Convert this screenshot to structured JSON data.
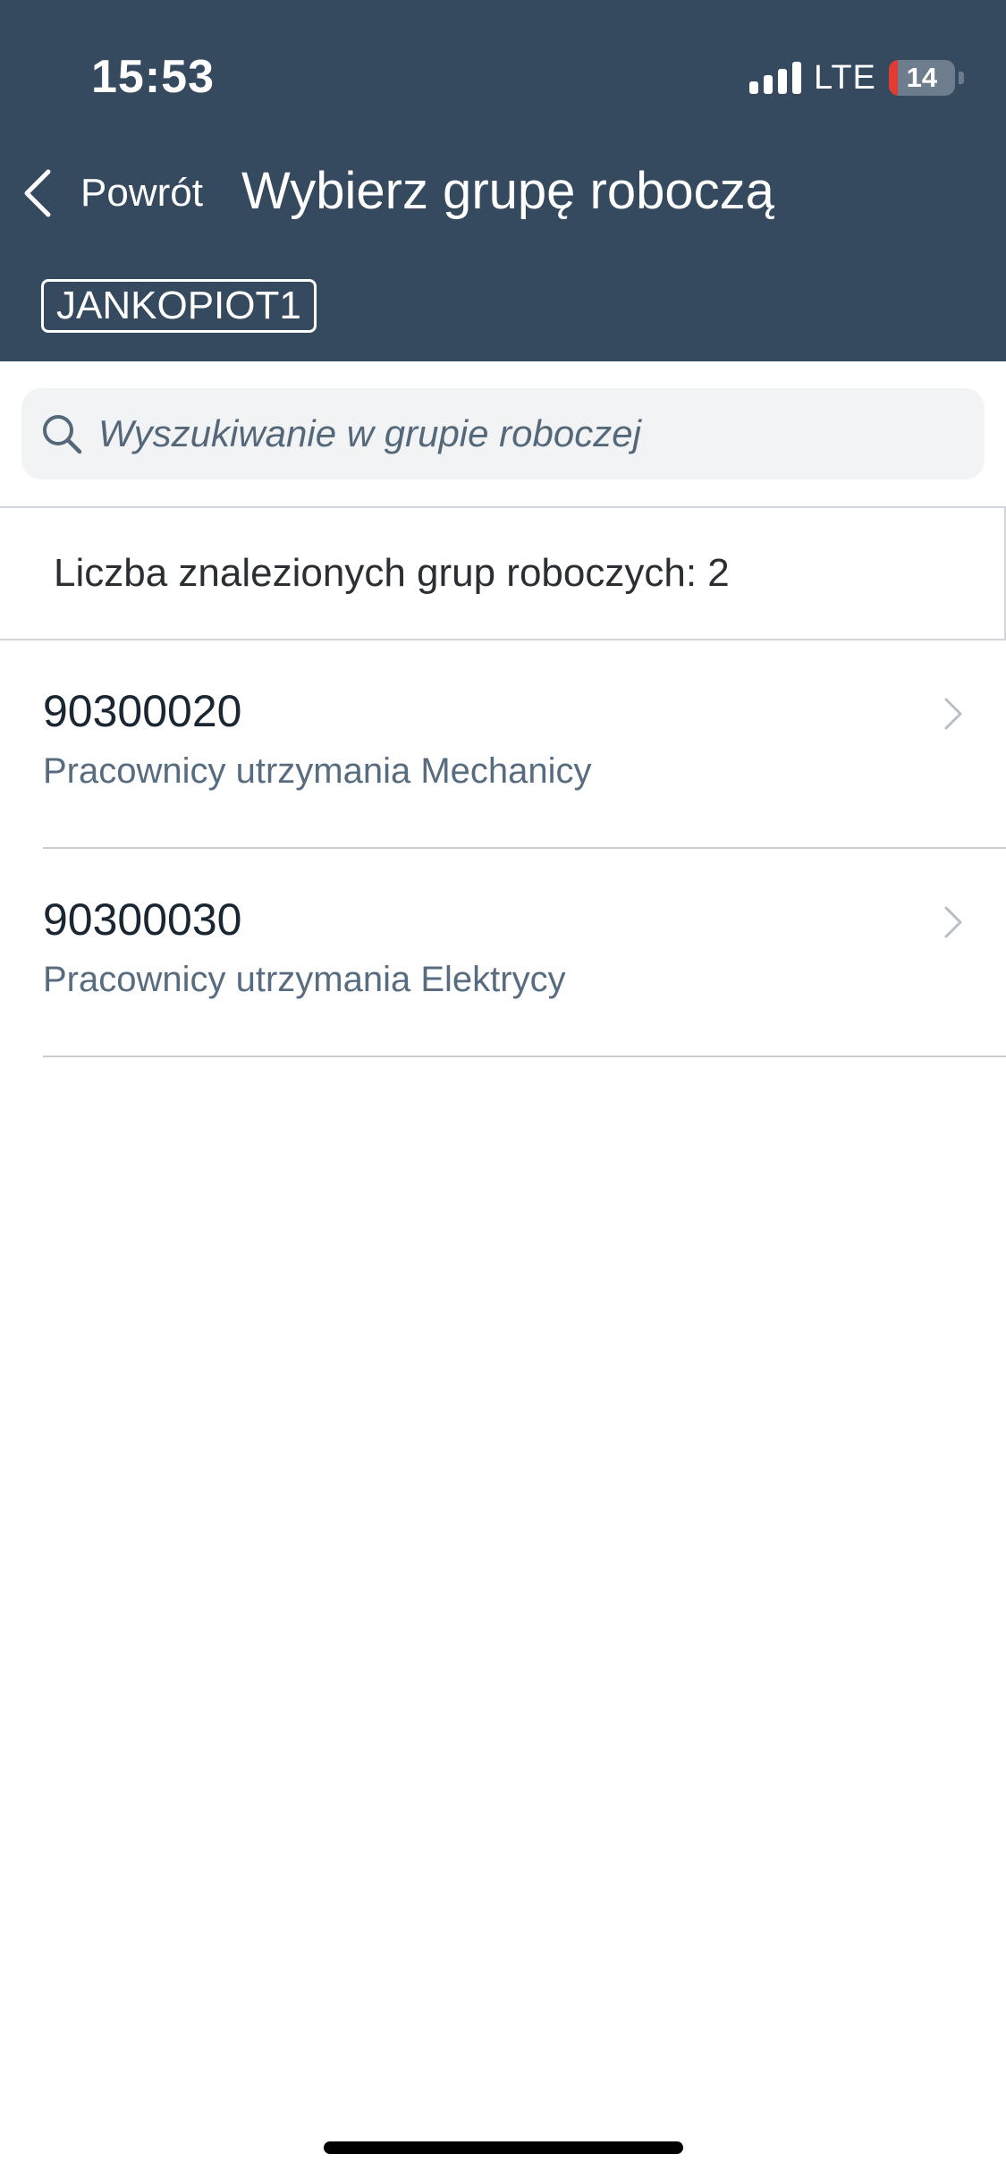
{
  "status_bar": {
    "time": "15:53",
    "network": "LTE",
    "battery_level": "14",
    "battery_fill_fraction": 0.14,
    "battery_fill_color": "#e23b33"
  },
  "nav": {
    "back_label": "Powrót",
    "title": "Wybierz grupę roboczą",
    "user_badge": "JANKOPIOT1"
  },
  "search": {
    "placeholder": "Wyszukiwanie w grupie roboczej",
    "value": "",
    "icon": "search-icon"
  },
  "results": {
    "count_text": "Liczba znalezionych grup roboczych: 2"
  },
  "workgroups": [
    {
      "code": "90300020",
      "description": "Pracownicy utrzymania Mechanicy"
    },
    {
      "code": "90300030",
      "description": "Pracownicy utrzymania Elektrycy"
    }
  ],
  "colors": {
    "header_bg": "#364a5f",
    "search_bg": "#f1f3f5",
    "secondary_text": "#586c80"
  }
}
